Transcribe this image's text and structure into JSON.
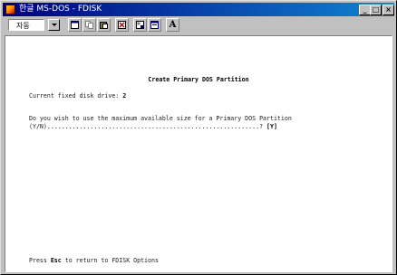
{
  "window": {
    "title": "한글 MS-DOS - FDISK",
    "controls": {
      "minimize": "_",
      "maximize": "□",
      "close": "×"
    }
  },
  "toolbar": {
    "font_combo_value": "자동",
    "buttons": [
      "window-icon",
      "copy-icon",
      "paste-icon",
      "fullscreen-icon",
      "properties-icon",
      "background-icon",
      "font-letter-icon"
    ],
    "font_button_label": "A"
  },
  "screen": {
    "heading": "Create Primary DOS Partition",
    "drive_label": "Current fixed disk drive: ",
    "drive_value": "2",
    "question_line1": "Do you wish to use the maximum available size for a Primary DOS Partition",
    "question_line2": "(Y/N)...........................................................? ",
    "answer": "[Y]",
    "footer_prefix": "Press ",
    "footer_key": "Esc",
    "footer_suffix": " to return to FDISK Options"
  }
}
